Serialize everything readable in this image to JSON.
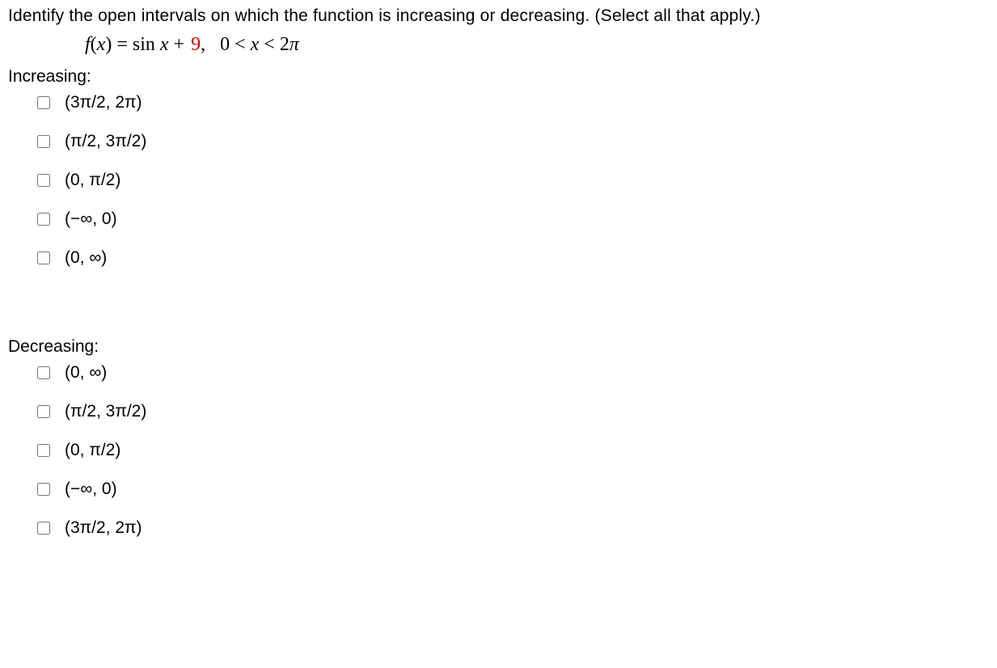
{
  "question": "Identify the open intervals on which the function is increasing or decreasing. (Select all that apply.)",
  "formula": {
    "lhs_f": "f",
    "lhs_open": "(",
    "lhs_var": "x",
    "lhs_close": ")",
    "eq": " = ",
    "sin": "sin ",
    "var": "x",
    "plus": " + ",
    "constant": "9",
    "comma": ",",
    "domain_lhs": "0 < ",
    "domain_var": "x",
    "domain_mid": " < 2",
    "domain_pi": "π"
  },
  "increasing": {
    "label": "Increasing:",
    "options": [
      "(3π/2, 2π)",
      "(π/2, 3π/2)",
      "(0, π/2)",
      "(−∞, 0)",
      "(0, ∞)"
    ]
  },
  "decreasing": {
    "label": "Decreasing:",
    "options": [
      "(0, ∞)",
      "(π/2, 3π/2)",
      "(0, π/2)",
      "(−∞, 0)",
      "(3π/2, 2π)"
    ]
  }
}
